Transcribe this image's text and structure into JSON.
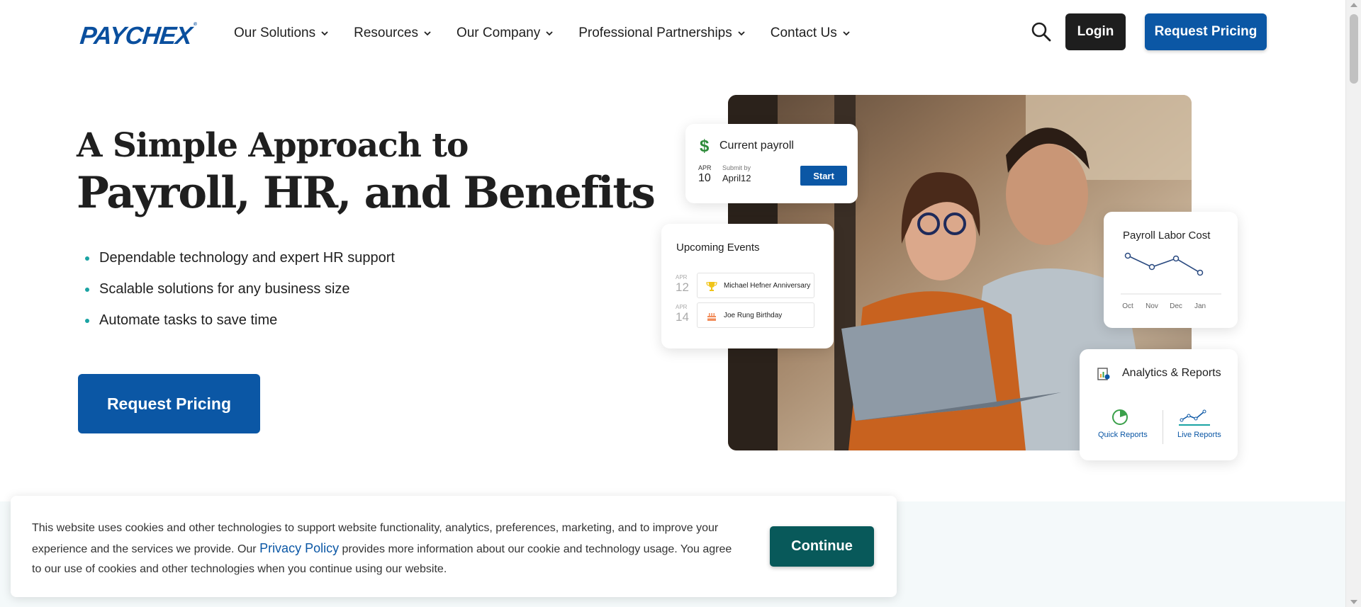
{
  "header": {
    "logo": "PAYCHEX",
    "nav": [
      {
        "label": "Our Solutions"
      },
      {
        "label": "Resources"
      },
      {
        "label": "Our Company"
      },
      {
        "label": "Professional Partnerships"
      },
      {
        "label": "Contact Us"
      }
    ],
    "search_icon": "search-icon",
    "login_label": "Login",
    "request_pricing_label": "Request Pricing"
  },
  "hero": {
    "title_line1": "A Simple Approach to",
    "title_line2": "Payroll, HR, and Benefits",
    "bullets": [
      "Dependable technology and expert HR support",
      "Scalable solutions for any business size",
      "Automate tasks to save time"
    ],
    "cta_label": "Request Pricing"
  },
  "cards": {
    "payroll": {
      "title": "Current payroll",
      "month": "APR",
      "day": "10",
      "submit_label": "Submit by",
      "submit_value": "April12",
      "start_label": "Start"
    },
    "events": {
      "title": "Upcoming Events",
      "items": [
        {
          "month": "APR",
          "day": "12",
          "label": "Michael Hefner Anniversary",
          "icon": "trophy-icon"
        },
        {
          "month": "APR",
          "day": "14",
          "label": "Joe Rung Birthday",
          "icon": "cake-icon"
        }
      ]
    },
    "labor": {
      "title": "Payroll Labor Cost",
      "months": [
        "Oct",
        "Nov",
        "Dec",
        "Jan"
      ],
      "values": [
        3,
        1,
        2.5,
        0
      ]
    },
    "reports": {
      "title": "Analytics & Reports",
      "quick_label": "Quick Reports",
      "live_label": "Live Reports"
    }
  },
  "cookie": {
    "text_before": "This website uses cookies and other technologies to support website functionality, analytics, preferences, marketing, and to improve your experience and the services we provide. Our ",
    "link_label": "Privacy Policy",
    "text_after": " provides more information about our cookie and technology usage. You agree to our use of cookies and other technologies when you continue using our website.",
    "continue_label": "Continue"
  },
  "colors": {
    "brand_blue": "#0b57a5",
    "accent_teal": "#1aa3a3",
    "continue_green": "#08595a",
    "login_dark": "#1e1e1e"
  }
}
